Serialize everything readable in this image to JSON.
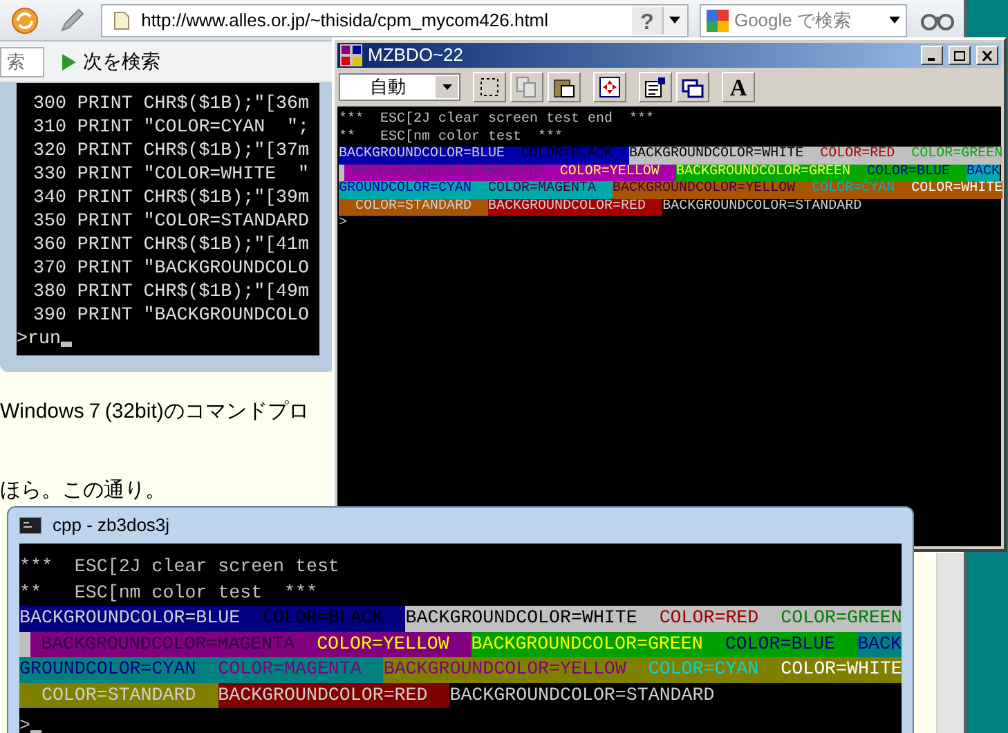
{
  "browser": {
    "url": "http://www.alles.or.jp/~thisida/cpm_mycom426.html",
    "help_button": "?",
    "search": {
      "placeholder": "Google で検索"
    }
  },
  "find_bar": {
    "placeholder": "索",
    "next_button": "次を検索"
  },
  "page": {
    "code_lines": [
      "300 PRINT CHR$($1B);\"[36m",
      "310 PRINT \"COLOR=CYAN  \";",
      "320 PRINT CHR$($1B);\"[37m",
      "330 PRINT \"COLOR=WHITE  \"",
      "340 PRINT CHR$($1B);\"[39m",
      "350 PRINT \"COLOR=STANDARD",
      "360 PRINT CHR$($1B);\"[41m",
      "370 PRINT \"BACKGROUNDCOLO",
      "380 PRINT CHR$($1B);\"[49m",
      "390 PRINT \"BACKGROUNDCOLO"
    ],
    "prompt": ">run",
    "paragraphs": [
      "Windows７(32bit)のコマンドプロ",
      "ほら。この通り。"
    ]
  },
  "mzbdo_window": {
    "title": "MZBDO~22",
    "font_dropdown": "自動",
    "font_button": "A",
    "lines": [
      "***  ESC[2J clear screen test end  ***",
      "**   ESC[nm color test  ***"
    ],
    "color_rows": [
      {
        "segments": [
          {
            "color": "#0000a8",
            "label": {
              "text": "BACKGROUNDCOLOR=BLUE  ",
              "kind": "standard"
            }
          },
          {
            "color": "#0000a8",
            "label": {
              "text": "COLOR=BLACK  ",
              "kind": "black"
            }
          },
          {
            "color": "#c0c0c0",
            "label": {
              "text": "BACKGROUNDCOLOR=WHITE  ",
              "kind": "black"
            }
          },
          {
            "color": "#c0c0c0",
            "label": {
              "text": "COLOR=RED  ",
              "kind": "red"
            }
          },
          {
            "color": "#c0c0c0",
            "label": {
              "text": "COLOR=GREEN",
              "kind": "green"
            }
          }
        ]
      },
      {
        "segments": [
          {
            "color": "#c0c0c0"
          },
          {
            "color": "#a800a8",
            "label": {
              "text": " BACKGROUNDCOLOR=MAGENTA  ",
              "kind": "dark"
            }
          },
          {
            "color": "#a800a8",
            "label": {
              "text": "COLOR=YELLOW  ",
              "kind": "yellow"
            }
          },
          {
            "color": "#00a800",
            "label": {
              "text": "BACKGROUNDCOLOR=GREEN  ",
              "kind": "yellow"
            }
          },
          {
            "color": "#00a800",
            "label": {
              "text": "COLOR=BLUE  ",
              "kind": "blue"
            }
          },
          {
            "color": "#00a8a8",
            "label": {
              "text": "BACK",
              "kind": "blue"
            }
          }
        ]
      },
      {
        "segments": [
          {
            "color": "#00a8a8",
            "label": {
              "text": "GROUNDCOLOR=CYAN  ",
              "kind": "blue"
            }
          },
          {
            "color": "#00a8a8",
            "label": {
              "text": "COLOR=MAGENTA  ",
              "kind": "magenta"
            }
          },
          {
            "color": "#a85400",
            "label": {
              "text": "BACKGROUNDCOLOR=YELLOW  ",
              "kind": "magenta"
            }
          },
          {
            "color": "#a85400",
            "label": {
              "text": "COLOR=CYAN  ",
              "kind": "cyan"
            }
          },
          {
            "color": "#a85400",
            "label": {
              "text": "COLOR=WHITE",
              "kind": "white"
            }
          }
        ]
      },
      {
        "segments": [
          {
            "color": "#a85400",
            "label": {
              "text": "  COLOR=STANDARD  ",
              "kind": "standard"
            }
          },
          {
            "color": "#a80000",
            "label": {
              "text": "BACKGROUNDCOLOR=RED  ",
              "kind": "standard"
            }
          },
          {
            "color": "#000000",
            "label": {
              "text": "BACKGROUNDCOLOR=STANDARD",
              "kind": "standard"
            }
          }
        ]
      }
    ],
    "prompt": ">"
  },
  "cpp_window": {
    "title": "cpp - zb3dos3j",
    "lines": [
      "***  ESC[2J clear screen test",
      "**   ESC[nm color test  ***"
    ],
    "color_rows": [
      {
        "segments": [
          {
            "color": "#000080",
            "label": {
              "text": "BACKGROUNDCOLOR=BLUE  ",
              "kind": "standard"
            }
          },
          {
            "color": "#000080",
            "label": {
              "text": "COLOR=BLACK  ",
              "kind": "black"
            }
          },
          {
            "color": "#c0c0c0",
            "label": {
              "text": "BACKGROUNDCOLOR=WHITE  ",
              "kind": "black"
            }
          },
          {
            "color": "#c0c0c0",
            "label": {
              "text": "COLOR=RED  ",
              "kind": "red"
            }
          },
          {
            "color": "#c0c0c0",
            "label": {
              "text": "COLOR=GREEN",
              "kind": "green"
            }
          }
        ]
      },
      {
        "segments": [
          {
            "color": "#c0c0c0"
          },
          {
            "color": "#800080",
            "label": {
              "text": " BACKGROUNDCOLOR=MAGENTA  ",
              "kind": "dark"
            }
          },
          {
            "color": "#800080",
            "label": {
              "text": "COLOR=YELLOW  ",
              "kind": "yellow"
            }
          },
          {
            "color": "#00a000",
            "label": {
              "text": "BACKGROUNDCOLOR=GREEN  ",
              "kind": "yellow"
            }
          },
          {
            "color": "#00a000",
            "label": {
              "text": "COLOR=BLUE  ",
              "kind": "blue"
            }
          },
          {
            "color": "#008080",
            "label": {
              "text": "BACK",
              "kind": "blue"
            }
          }
        ]
      },
      {
        "segments": [
          {
            "color": "#008080",
            "label": {
              "text": "GROUNDCOLOR=CYAN  ",
              "kind": "blue"
            }
          },
          {
            "color": "#008080",
            "label": {
              "text": "COLOR=MAGENTA  ",
              "kind": "magenta"
            }
          },
          {
            "color": "#808000",
            "label": {
              "text": "BACKGROUNDCOLOR=YELLOW  ",
              "kind": "magenta"
            }
          },
          {
            "color": "#808000",
            "label": {
              "text": "COLOR=CYAN  ",
              "kind": "cyan"
            }
          },
          {
            "color": "#808000",
            "label": {
              "text": "COLOR=WHITE",
              "kind": "white"
            }
          }
        ]
      },
      {
        "segments": [
          {
            "color": "#808000",
            "label": {
              "text": "  COLOR=STANDARD  ",
              "kind": "standard"
            }
          },
          {
            "color": "#800000",
            "label": {
              "text": "BACKGROUNDCOLOR=RED  ",
              "kind": "standard"
            }
          },
          {
            "color": "#000000",
            "label": {
              "text": "BACKGROUNDCOLOR=STANDARD",
              "kind": "standard"
            }
          }
        ]
      }
    ],
    "prompt": ">"
  }
}
